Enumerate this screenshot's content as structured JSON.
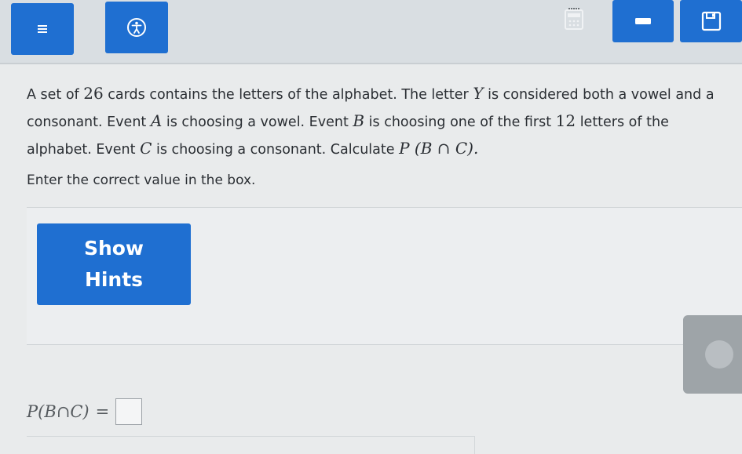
{
  "toolbar": {
    "menu_icon": "hamburger-menu-icon",
    "a11y_icon": "accessibility-icon",
    "calc_icon": "calculator-icon",
    "min_icon": "minimize-icon",
    "save_icon": "save-icon"
  },
  "question": {
    "t1": "A set of ",
    "n26": "26",
    "t2": " cards contains the letters of the alphabet. The letter ",
    "Y": "Y",
    "t3": " is considered both a vowel and a consonant. Event ",
    "A": "A",
    "t4": " is choosing a vowel. Event ",
    "B": "B",
    "t5": " is choosing one of the first ",
    "n12": "12",
    "t6": " letters of the alphabet. Event ",
    "C": "C",
    "t7": " is choosing a consonant. Calculate ",
    "expr": "P (B ∩ C).",
    "instruction": "Enter the correct value in the box."
  },
  "hints": {
    "line1": "Show",
    "line2": "Hints"
  },
  "answer": {
    "expr": "P(B∩C)",
    "equals": "="
  },
  "colors": {
    "accent": "#1f6fd1",
    "background": "#e9ebec",
    "topbar": "#d9dee2"
  }
}
